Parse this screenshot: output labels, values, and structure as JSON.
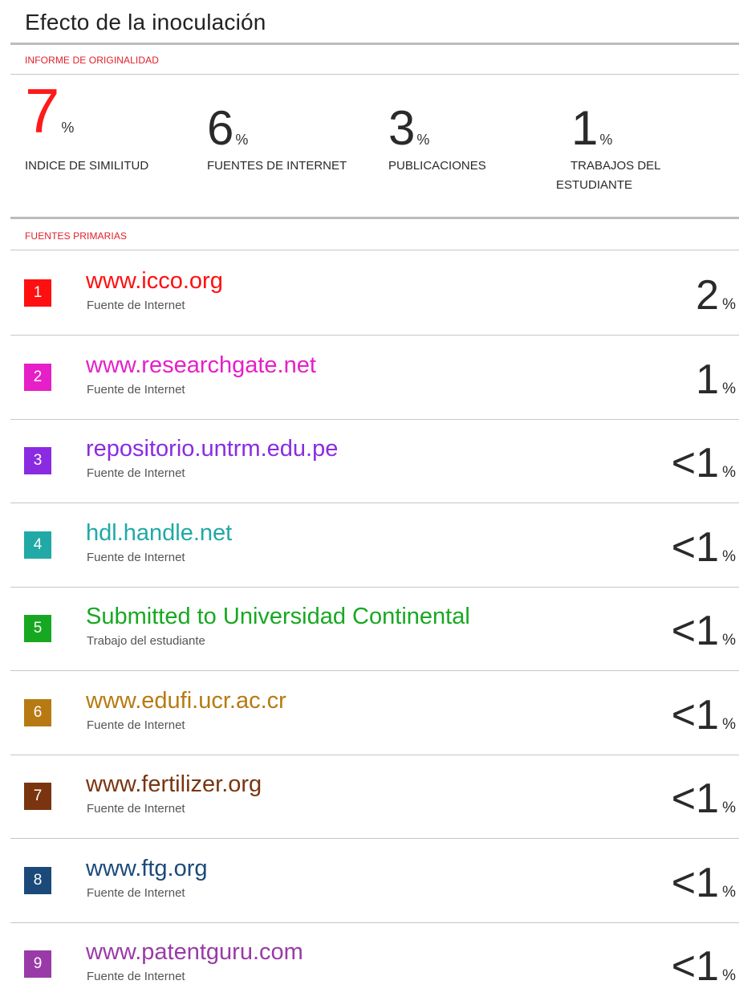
{
  "title": "Efecto de la inoculación",
  "originality_label": "INFORME DE ORIGINALIDAD",
  "stats": [
    {
      "value": "7",
      "unit": "%",
      "caption": "INDICE DE SIMILITUD"
    },
    {
      "value": "6",
      "unit": "%",
      "caption": "FUENTES DE INTERNET"
    },
    {
      "value": "3",
      "unit": "%",
      "caption": "PUBLICACIONES"
    },
    {
      "value": "1",
      "unit": "%",
      "caption_line1": "TRABAJOS DEL",
      "caption_line2": "ESTUDIANTE"
    }
  ],
  "primary_sources_label": "FUENTES PRIMARIAS",
  "sources": [
    {
      "rank": "1",
      "name": "www.icco.org",
      "type": "Fuente de Internet",
      "pct": "2",
      "unit": "%",
      "color": "#ff0f0f"
    },
    {
      "rank": "2",
      "name": "www.researchgate.net",
      "type": "Fuente de Internet",
      "pct": "1",
      "unit": "%",
      "color": "#e61fc8"
    },
    {
      "rank": "3",
      "name": "repositorio.untrm.edu.pe",
      "type": "Fuente de Internet",
      "pct": "<1",
      "unit": "%",
      "color": "#8a2be2"
    },
    {
      "rank": "4",
      "name": "hdl.handle.net",
      "type": "Fuente de Internet",
      "pct": "<1",
      "unit": "%",
      "color": "#20a9a6"
    },
    {
      "rank": "5",
      "name": "Submitted to Universidad Continental",
      "type": "Trabajo del estudiante",
      "pct": "<1",
      "unit": "%",
      "color": "#17a822"
    },
    {
      "rank": "6",
      "name": "www.edufi.ucr.ac.cr",
      "type": "Fuente de Internet",
      "pct": "<1",
      "unit": "%",
      "color": "#b77a12"
    },
    {
      "rank": "7",
      "name": "www.fertilizer.org",
      "type": "Fuente de Internet",
      "pct": "<1",
      "unit": "%",
      "color": "#7a3510"
    },
    {
      "rank": "8",
      "name": "www.ftg.org",
      "type": "Fuente de Internet",
      "pct": "<1",
      "unit": "%",
      "color": "#1b4a7a"
    },
    {
      "rank": "9",
      "name": "www.patentguru.com",
      "type": "Fuente de Internet",
      "pct": "<1",
      "unit": "%",
      "color": "#9a3aa8"
    }
  ]
}
